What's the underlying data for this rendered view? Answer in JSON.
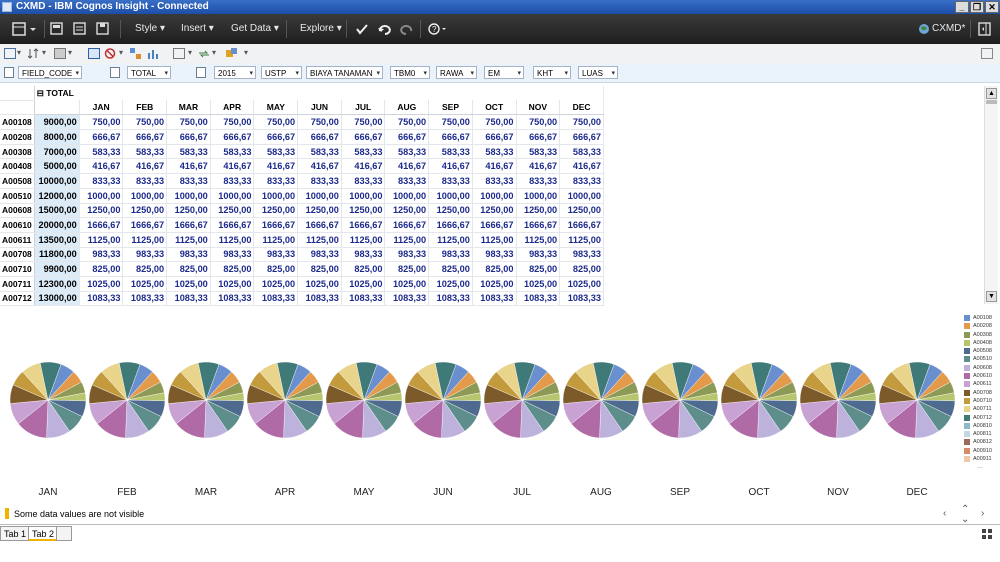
{
  "window": {
    "title": "CXMD - IBM Cognos Insight - Connected",
    "min": "_",
    "restore": "❐",
    "close": "✕"
  },
  "toolbar": {
    "menus": [
      "Style",
      "Insert",
      "Get Data",
      "Explore"
    ],
    "connection_label": "CXMD*",
    "arrow": "▾"
  },
  "dimensions": [
    {
      "name": "field",
      "value": "FIELD_CODE"
    },
    {
      "name": "total",
      "value": "TOTAL"
    },
    {
      "name": "year",
      "value": "2015"
    },
    {
      "name": "ustp",
      "value": "USTP"
    },
    {
      "name": "biaya",
      "value": "BIAYA TANAMAN"
    },
    {
      "name": "tbm",
      "value": "TBM0"
    },
    {
      "name": "rawa",
      "value": "RAWA"
    },
    {
      "name": "em",
      "value": "EM"
    },
    {
      "name": "kht",
      "value": "KHT"
    },
    {
      "name": "luas",
      "value": "LUAS"
    }
  ],
  "table": {
    "total_header": "TOTAL",
    "collapse_glyph": "⊟",
    "months": [
      "JAN",
      "FEB",
      "MAR",
      "APR",
      "MAY",
      "JUN",
      "JUL",
      "AUG",
      "SEP",
      "OCT",
      "NOV",
      "DEC"
    ],
    "rows": [
      {
        "code": "A00108",
        "total": "9000,00",
        "monthly": "750,00"
      },
      {
        "code": "A00208",
        "total": "8000,00",
        "monthly": "666,67"
      },
      {
        "code": "A00308",
        "total": "7000,00",
        "monthly": "583,33"
      },
      {
        "code": "A00408",
        "total": "5000,00",
        "monthly": "416,67"
      },
      {
        "code": "A00508",
        "total": "10000,00",
        "monthly": "833,33"
      },
      {
        "code": "A00510",
        "total": "12000,00",
        "monthly": "1000,00"
      },
      {
        "code": "A00608",
        "total": "15000,00",
        "monthly": "1250,00"
      },
      {
        "code": "A00610",
        "total": "20000,00",
        "monthly": "1666,67"
      },
      {
        "code": "A00611",
        "total": "13500,00",
        "monthly": "1125,00"
      },
      {
        "code": "A00708",
        "total": "11800,00",
        "monthly": "983,33"
      },
      {
        "code": "A00710",
        "total": "9900,00",
        "monthly": "825,00"
      },
      {
        "code": "A00711",
        "total": "12300,00",
        "monthly": "1025,00"
      },
      {
        "code": "A00712",
        "total": "13000,00",
        "monthly": "1083,33"
      }
    ]
  },
  "chart_data": {
    "type": "pie",
    "categories": [
      "JAN",
      "FEB",
      "MAR",
      "APR",
      "MAY",
      "JUN",
      "JUL",
      "AUG",
      "SEP",
      "OCT",
      "NOV",
      "DEC"
    ],
    "slices": [
      {
        "name": "A00108",
        "value": 750.0,
        "color": "#6a8fcf"
      },
      {
        "name": "A00208",
        "value": 666.67,
        "color": "#e39a4a"
      },
      {
        "name": "A00308",
        "value": 583.33,
        "color": "#8c9a55"
      },
      {
        "name": "A00408",
        "value": 416.67,
        "color": "#b7c66e"
      },
      {
        "name": "A00508",
        "value": 833.33,
        "color": "#4e6a8f"
      },
      {
        "name": "A00510",
        "value": 1000.0,
        "color": "#5d8e8c"
      },
      {
        "name": "A00608",
        "value": 1250.0,
        "color": "#bcb2dc"
      },
      {
        "name": "A00610",
        "value": 1666.67,
        "color": "#b06aa6"
      },
      {
        "name": "A00611",
        "value": 1125.0,
        "color": "#c9a2d4"
      },
      {
        "name": "A00708",
        "value": 983.33,
        "color": "#7c5a2a"
      },
      {
        "name": "A00710",
        "value": 825.0,
        "color": "#c39a3c"
      },
      {
        "name": "A00711",
        "value": 1025.0,
        "color": "#e9d48c"
      },
      {
        "name": "A00712",
        "value": 1083.33,
        "color": "#3f7a78"
      },
      {
        "name": "A00810",
        "value": 0,
        "color": "#8fb8c8"
      },
      {
        "name": "A00811",
        "value": 0,
        "color": "#c3d6e6"
      },
      {
        "name": "A00812",
        "value": 0,
        "color": "#9a6a5a"
      },
      {
        "name": "A00910",
        "value": 0,
        "color": "#d58a6a"
      },
      {
        "name": "A00911",
        "value": 0,
        "color": "#f0c8a8"
      }
    ],
    "legend_more": "..."
  },
  "status": {
    "message": "Some data values are not visible",
    "nav_left": "‹",
    "nav_up": "⌃",
    "nav_down": "⌄",
    "nav_right": "›"
  },
  "tabs": [
    "Tab 1",
    "Tab 2"
  ]
}
